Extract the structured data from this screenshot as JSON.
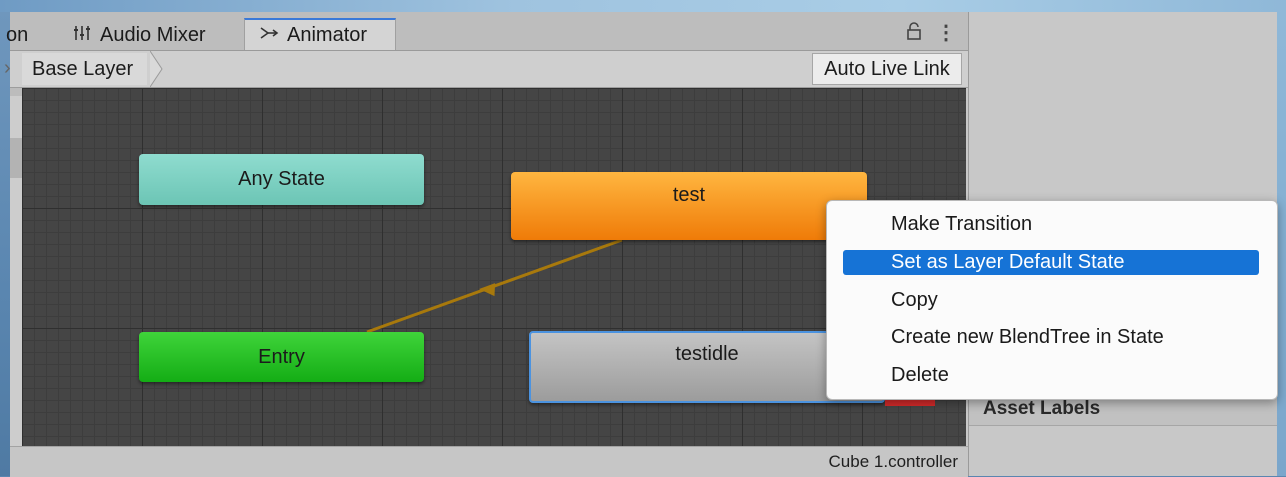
{
  "tabs": {
    "partial_label": "on",
    "audio_mixer": {
      "label": "Audio Mixer"
    },
    "animator": {
      "label": "Animator"
    }
  },
  "breadcrumb": {
    "label": "Base Layer"
  },
  "toolbar": {
    "auto_live_link": "Auto Live Link"
  },
  "states": {
    "any_state": "Any State",
    "entry": "Entry",
    "test": "test",
    "testidle": "testidle"
  },
  "status": {
    "controller": "Cube 1.controller"
  },
  "inspector": {
    "asset_labels": "Asset Labels"
  },
  "context_menu": {
    "items": [
      {
        "label": "Make Transition"
      },
      {
        "label": "Set as Layer Default State",
        "highlighted": true
      },
      {
        "label": "Copy"
      },
      {
        "label": "Create new BlendTree in State"
      },
      {
        "label": "Delete"
      }
    ]
  },
  "colors": {
    "accent": "#1673d6",
    "any_state": "#7fd2c4",
    "entry": "#22c022",
    "default_state": "#f08a14",
    "state": "#b0b0b0",
    "transition": "#b8860b"
  }
}
